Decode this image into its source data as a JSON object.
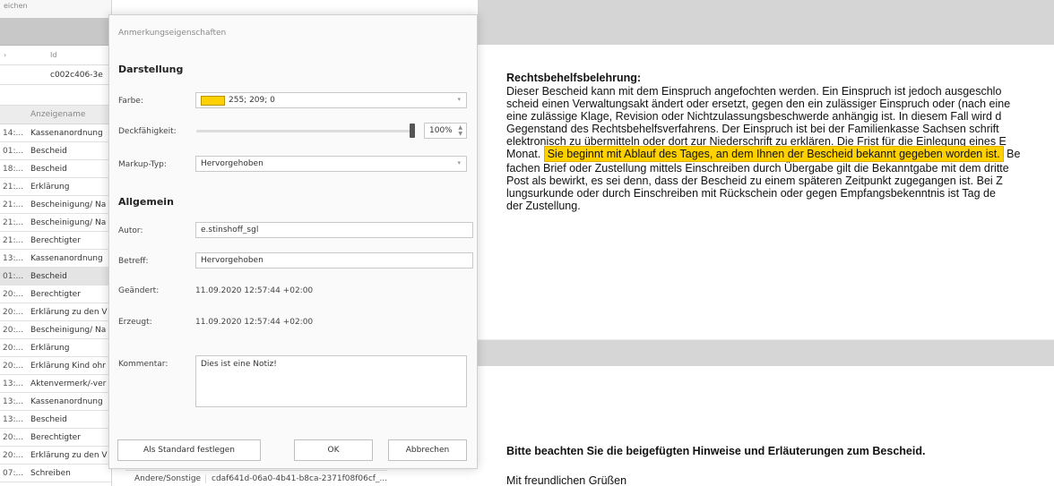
{
  "left_table": {
    "top_text": "eichen",
    "id_header": "Id",
    "id_value": "c002c406-3e",
    "col_header": "Anzeigename",
    "rows": [
      {
        "time": "14:...",
        "name": "Kassenanordnung"
      },
      {
        "time": "01:...",
        "name": "Bescheid"
      },
      {
        "time": "18:...",
        "name": "Bescheid"
      },
      {
        "time": "21:...",
        "name": "Erklärung"
      },
      {
        "time": "21:...",
        "name": "Bescheinigung/ Na"
      },
      {
        "time": "21:...",
        "name": "Bescheinigung/ Na"
      },
      {
        "time": "21:...",
        "name": "Berechtigter"
      },
      {
        "time": "13:...",
        "name": "Kassenanordnung"
      },
      {
        "time": "01:...",
        "name": "Bescheid"
      },
      {
        "time": "20:...",
        "name": "Berechtigter"
      },
      {
        "time": "20:...",
        "name": "Erklärung zu den V"
      },
      {
        "time": "20:...",
        "name": "Bescheinigung/ Na"
      },
      {
        "time": "20:...",
        "name": "Erklärung"
      },
      {
        "time": "20:...",
        "name": "Erklärung Kind ohr"
      },
      {
        "time": "13:...",
        "name": "Aktenvermerk/-ver"
      },
      {
        "time": "13:...",
        "name": "Kassenanordnung"
      },
      {
        "time": "13:...",
        "name": "Bescheid"
      },
      {
        "time": "20:...",
        "name": "Berechtigter"
      },
      {
        "time": "20:...",
        "name": "Erklärung zu den V"
      },
      {
        "time": "07:...",
        "name": "Schreiben"
      }
    ],
    "bottom_category": "Andere/Sonstige",
    "bottom_id": "cdaf641d-06a0-4b41-b8ca-2371f08f06cf_..."
  },
  "dialog": {
    "title": "Anmerkungseigenschaften",
    "section_display": "Darstellung",
    "color_label": "Farbe:",
    "color_value": "255; 209; 0",
    "color_hex": "#ffd100",
    "opacity_label": "Deckfähigkeit:",
    "opacity_value": "100%",
    "opacity_fraction": 1.0,
    "markup_label": "Markup-Typ:",
    "markup_value": "Hervorgehoben",
    "section_general": "Allgemein",
    "author_label": "Autor:",
    "author_value": "e.stinshoff_sgl",
    "subject_label": "Betreff:",
    "subject_value": "Hervorgehoben",
    "changed_label": "Geändert:",
    "changed_value": "11.09.2020 12:57:44 +02:00",
    "created_label": "Erzeugt:",
    "created_value": "11.09.2020 12:57:44 +02:00",
    "comment_label": "Kommentar:",
    "comment_value": "Dies ist eine Notiz!",
    "btn_default": "Als Standard festlegen",
    "btn_ok": "OK",
    "btn_cancel": "Abbrechen"
  },
  "document": {
    "rb_title": "Rechtsbehelfsbelehrung:",
    "lines": [
      "Dieser Bescheid kann mit dem Einspruch angefochten werden. Ein Einspruch ist jedoch ausgeschlo",
      "scheid einen Verwaltungsakt ändert oder ersetzt, gegen den ein zulässiger Einspruch oder (nach eine",
      "eine zulässige Klage, Revision oder Nichtzulassungsbeschwerde anhängig ist. In diesem Fall wird d",
      "Gegenstand des Rechtsbehelfsverfahrens. Der Einspruch ist bei der Familienkasse Sachsen schrift",
      "elektronisch zu übermitteln oder dort zur Niederschrift zu erklären. Die Frist für die Einlegung eines E"
    ],
    "line6_before": "Monat.",
    "line6_highlight": "Sie beginnt mit Ablauf des Tages, an dem Ihnen der Bescheid bekannt gegeben worden ist.",
    "line6_after": "Be",
    "lines_after": [
      "fachen Brief oder Zustellung mittels Einschreiben durch Übergabe gilt die Bekanntgabe mit dem dritte",
      "Post als bewirkt, es sei denn, dass der Bescheid zu einem späteren Zeitpunkt zugegangen ist. Bei Z",
      "lungsurkunde oder durch Einschreiben mit Rückschein oder gegen Empfangsbekenntnis ist Tag de",
      "der Zustellung."
    ],
    "note": "Bitte beachten Sie die beigefügten Hinweise und Erläuterungen zum Bescheid.",
    "greeting": "Mit freundlichen Grüßen"
  }
}
